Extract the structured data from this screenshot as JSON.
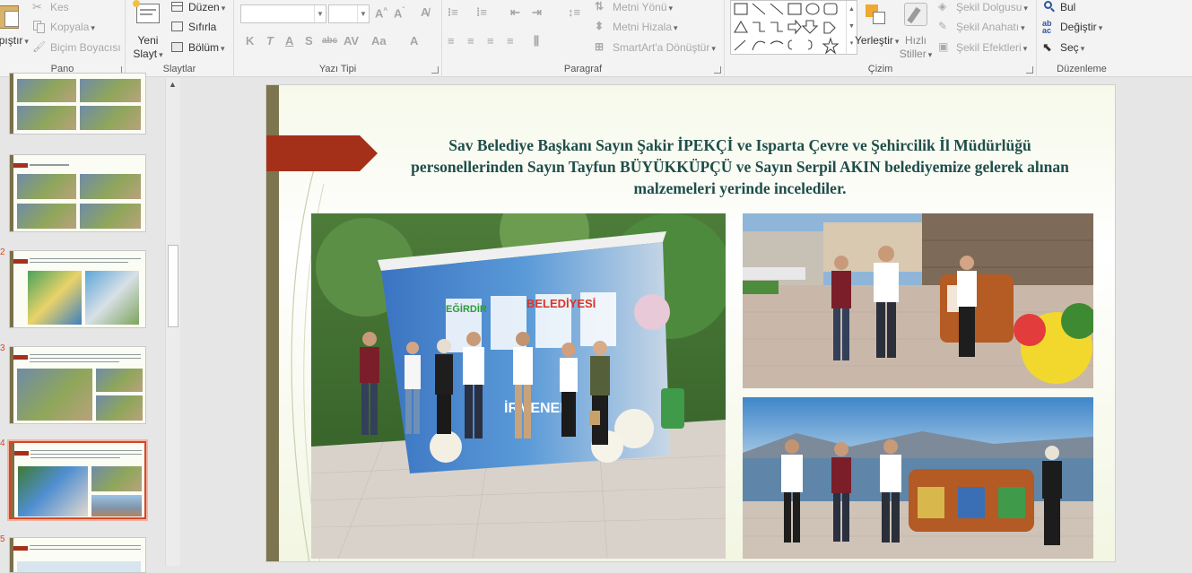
{
  "ribbon": {
    "clipboard": {
      "paste": "apıştır",
      "cut": "Kes",
      "copy": "Kopyala",
      "format_painter": "Biçim Boyacısı",
      "label": "Pano"
    },
    "slides": {
      "new_slide_line1": "Yeni",
      "new_slide_line2": "Slayt",
      "layout": "Düzen",
      "reset": "Sıfırla",
      "section": "Bölüm",
      "label": "Slaytlar"
    },
    "font": {
      "label": "Yazı Tipi"
    },
    "paragraph": {
      "text_direction": "Metni Yönü",
      "align_text": "Metni Hizala",
      "smartart": "SmartArt'a Dönüştür",
      "label": "Paragraf"
    },
    "drawing": {
      "arrange": "Yerleştir",
      "quick_styles_line1": "Hızlı",
      "quick_styles_line2": "Stiller",
      "shape_fill": "Şekil Dolgusu",
      "shape_outline": "Şekil Anahatı",
      "shape_effects": "Şekil Efektleri",
      "label": "Çizim"
    },
    "editing": {
      "find": "Bul",
      "replace": "Değiştir",
      "select": "Seç",
      "label": "Düzenleme"
    }
  },
  "thumbnails": [
    {
      "num": ""
    },
    {
      "num": ""
    },
    {
      "num": "2"
    },
    {
      "num": "3"
    },
    {
      "num": "4",
      "selected": true
    },
    {
      "num": "5"
    }
  ],
  "slide": {
    "title": "Sav Belediye Başkanı  Sayın Şakir İPEKÇİ ve Isparta Çevre ve Şehircilik İl Müdürlüğü personellerinden Sayın  Tayfun BÜYÜKKÜPÇÜ ve Sayın  Serpil AKIN belediyemize gelerek   alınan malzemeleri yerinde incelediler.",
    "photo_sign_1": "EĞİRDİR",
    "photo_sign_2": "BELEDİYESİ",
    "photo_sign_3": "İRMENER"
  },
  "colors": {
    "accent": "#d24726",
    "slide_bar": "#7d7450",
    "title": "#1f4e4a",
    "arrow": "#a4301a"
  }
}
